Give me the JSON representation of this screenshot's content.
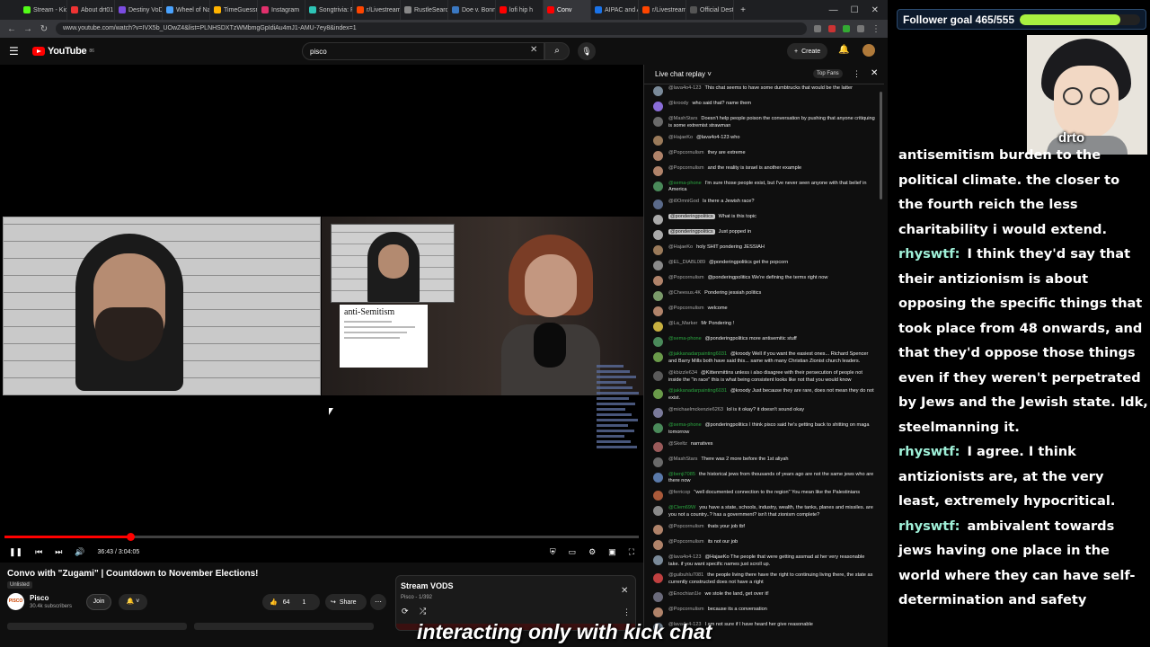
{
  "browser": {
    "tabs": [
      {
        "label": "Stream - Kick",
        "color": "#53fc18"
      },
      {
        "label": "About drt01",
        "color": "#e33"
      },
      {
        "label": "Destiny VoD",
        "color": "#7b4ce0"
      },
      {
        "label": "Wheel of Na",
        "color": "#4aa3ff"
      },
      {
        "label": "TimeGuessr",
        "color": "#ffb300"
      },
      {
        "label": "Instagram",
        "color": "#e1306c"
      },
      {
        "label": "Songtrivia: F",
        "color": "#2ec4b6"
      },
      {
        "label": "r/Livestream",
        "color": "#ff4500"
      },
      {
        "label": "RustleSearch",
        "color": "#888"
      },
      {
        "label": "Doe v. Bonne",
        "color": "#3a78c2"
      },
      {
        "label": "lofi hip h",
        "color": "#f00"
      },
      {
        "label": "Conv",
        "color": "#f00"
      },
      {
        "label": "AIPAC and A",
        "color": "#1a73e8"
      },
      {
        "label": "r/Livestream",
        "color": "#ff4500"
      },
      {
        "label": "Official Desti",
        "color": "#555"
      }
    ],
    "url": "www.youtube.com/watch?v=IVX5b_UOwZ4&list=PLNHSDXTzWMbmgGpIdiAu4mJ1-AMU-7ey8&index=1"
  },
  "youtube": {
    "logo_text": "YouTube",
    "logo_country": "86",
    "search_value": "pisco",
    "create_label": "Create"
  },
  "video": {
    "time": "36:43 / 3:04:05",
    "progress": 0.199,
    "definition_title": "anti-Semitism"
  },
  "below": {
    "title": "Convo with \"Zugami\" | Countdown to November Elections!",
    "unlisted": "Unlisted",
    "channel": "Pisco",
    "subscribers": "30.4k subscribers",
    "join": "Join",
    "likes": "64",
    "dislikes": "1",
    "share": "Share"
  },
  "playlist": {
    "title": "Stream VODS",
    "sub": "Pisco - 1/392"
  },
  "chat": {
    "header": "Live chat replay",
    "top_fans": "Top Fans",
    "messages": [
      {
        "author": "@lava4o4-123",
        "text": "This chat seems to have some dumbtrucks that would be the latter",
        "color": "#7a8a99"
      },
      {
        "author": "@kroody",
        "text": "who said that? name them",
        "color": "#8a6dd8"
      },
      {
        "author": "@MashStars",
        "text": "Doesn't help people poison the conversation by pushing that anyone critiquing is some extremist strawman",
        "color": "#6a6a6a"
      },
      {
        "author": "@HajaeKo",
        "text": "@lava4o4-123 who",
        "color": "#9a7a5a"
      },
      {
        "author": "@Popcornulism",
        "text": "they are extreme",
        "color": "#b0836a"
      },
      {
        "author": "@Popcornulism",
        "text": "and the reality is israel is another example",
        "color": "#b0836a"
      },
      {
        "author": "@sema-phone",
        "text": "I'm sure those people exist, but I've never seen anyone with that belief in America",
        "color": "#4a8a5a",
        "mod": true
      },
      {
        "author": "@i0OmniGod",
        "text": "Is there a Jewish race?",
        "color": "#5a6a8a"
      },
      {
        "author": "@ponderingpolitics",
        "text": "What is this topic",
        "color": "#aaaaaa",
        "badge": true
      },
      {
        "author": "@ponderingpolitics",
        "text": "Just popped in",
        "color": "#aaaaaa",
        "badge": true
      },
      {
        "author": "@HajaeKo",
        "text": "holy SHIT pondering JESSIAH",
        "color": "#9a7a5a"
      },
      {
        "author": "@EL_DIABL089",
        "text": "@ponderingpolitics get the popcorn",
        "color": "#8a8a8a"
      },
      {
        "author": "@Popcornulism",
        "text": "@ponderingpolitics We're defining the terms right now",
        "color": "#b0836a"
      },
      {
        "author": "@Cheesus.4K",
        "text": "Pondering jessiah politics",
        "color": "#7a9a6a"
      },
      {
        "author": "@Popcornulism",
        "text": "welcome",
        "color": "#b0836a"
      },
      {
        "author": "@La_Marker",
        "text": "Mr Pondering !",
        "color": "#c8b040"
      },
      {
        "author": "@sema-phone",
        "text": "@ponderingpolitics more antisemitic stuff",
        "color": "#4a8a5a",
        "mod": true
      },
      {
        "author": "@jakkanadarpainting6031",
        "text": "@kroody Well if you want the easiest ones... Richard Spencer and Barry Mills both have said this... same with many Christian Zionist church leaders.",
        "color": "#6a9a4a",
        "mod": true
      },
      {
        "author": "@kbizzle634",
        "text": "@Kittenmittins unless i also disagree with their persecution of people not inside the \"in race\" this is what being consistent looks like not that you would know",
        "color": "#5a5a5a"
      },
      {
        "author": "@jakkanadarpainting6031",
        "text": "@kroody Just because they are rare, does not mean they do not exist.",
        "color": "#6a9a4a",
        "mod": true
      },
      {
        "author": "@michaelmckenzie6263",
        "text": "lol is it okay? it doesn't sound okay",
        "color": "#7a7a9a"
      },
      {
        "author": "@sema-phone",
        "text": "@ponderingpolitics I think pisco said he's getting back to shitting on maga tomorrow",
        "color": "#4a8a5a",
        "mod": true
      },
      {
        "author": "@Skeltz",
        "text": "narratives",
        "color": "#9a5a5a"
      },
      {
        "author": "@MashStars",
        "text": "There was 2 more before the 1st aliyah",
        "color": "#6a6a6a"
      },
      {
        "author": "@benji7085",
        "text": "the historical jews from thousands of years ago are not the same jews who are there now",
        "color": "#5a7aaa",
        "mod": true
      },
      {
        "author": "@ferricop",
        "text": "\"well documented connection to the region\" You mean like the Palestinians",
        "color": "#aa5a3a"
      },
      {
        "author": "@Clem69W",
        "text": "you have a state, schools, industry, wealth, the tanks, planes and missiles. are you not a country..? has a government? isn't that zionism complete?",
        "color": "#8a8a8a",
        "mod": true
      },
      {
        "author": "@Popcornulism",
        "text": "thats your job tbf",
        "color": "#b0836a"
      },
      {
        "author": "@Popcornulism",
        "text": "its not our job",
        "color": "#b0836a"
      },
      {
        "author": "@lava4o4-123",
        "text": "@HajaeKo The people that were getting assmad at her very reasonable take. if you want specific names just scroll up.",
        "color": "#7a8a99"
      },
      {
        "author": "@guibuhlu7081",
        "text": "the people living there have the right to continuing living there, the state as currently constructed does not have a right",
        "color": "#c04040"
      },
      {
        "author": "@Enochian1le",
        "text": "we stole the land, get over it!",
        "color": "#6a6a7a"
      },
      {
        "author": "@Popcornulism",
        "text": "because its a conversation",
        "color": "#b0836a"
      },
      {
        "author": "@lava4o4-123",
        "text": "I am not sure if I have heard her give reasonable",
        "color": "#7a8a99"
      }
    ]
  },
  "side": {
    "follower_goal": "Follower goal 465/555",
    "goal_progress": 0.838,
    "avatar_name": "drto",
    "lines": [
      {
        "user": "",
        "text": "antisemitism burden to the political climate. the closer to the fourth reich the less charitability i would extend."
      },
      {
        "user": "rhyswtf:",
        "text": "I think they'd say that their antizionism is about opposing the specific things that took place from 48 onwards, and that they'd oppose those things even if they weren't perpetrated by Jews and the Jewish state. Idk, steelmanning it."
      },
      {
        "user": "rhyswtf:",
        "text": "I agree. I think antizionists are, at the very least, extremely hypocritical."
      },
      {
        "user": "rhyswtf:",
        "text": "ambivalent towards jews having one place in the world where they can have self-determination and safety"
      }
    ]
  },
  "caption": "interacting only with kick chat"
}
